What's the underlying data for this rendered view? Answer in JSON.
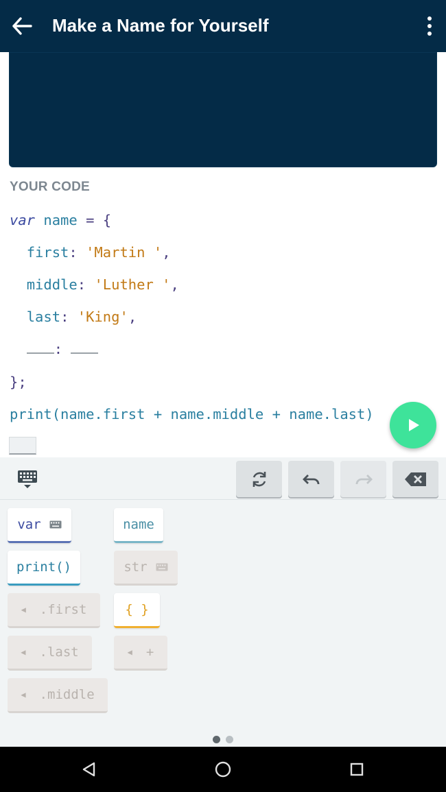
{
  "app_bar": {
    "title": "Make a Name for Yourself",
    "background": "#042b47"
  },
  "editor": {
    "section_label": "YOUR CODE",
    "lines": {
      "l1": {
        "kw": "var",
        "ident": "name",
        "rest": " = {"
      },
      "l2": {
        "key": "first",
        "sep": ": ",
        "value": "'Martin '",
        "end": ","
      },
      "l3": {
        "key": "middle",
        "sep": ": ",
        "value": "'Luther '",
        "end": ","
      },
      "l4": {
        "key": "last",
        "sep": ": ",
        "value": "'King'",
        "end": ","
      },
      "l5": {
        "sep": ": "
      },
      "l6": {
        "text": "};"
      },
      "l7": {
        "text": "print(name.first + name.middle + name.last)"
      }
    }
  },
  "run_button": {
    "icon": "play-icon",
    "color": "#3ee39a"
  },
  "keyboard": {
    "toolbar": {
      "toggle_icon": "keyboard-hide-icon",
      "buttons": [
        "refresh-icon",
        "undo-icon",
        "redo-icon",
        "backspace-icon"
      ]
    },
    "chips": {
      "var": "var",
      "name": "name",
      "print": "print()",
      "str": "str",
      "first": ".first",
      "braces": "{ }",
      "last": ".last",
      "plus": "+",
      "middle": ".middle"
    },
    "pager": {
      "pages": 2,
      "active": 1
    }
  },
  "colors": {
    "keyword": "#3b4aa0",
    "string": "#c27a16",
    "identifier": "#2a7fa0"
  }
}
